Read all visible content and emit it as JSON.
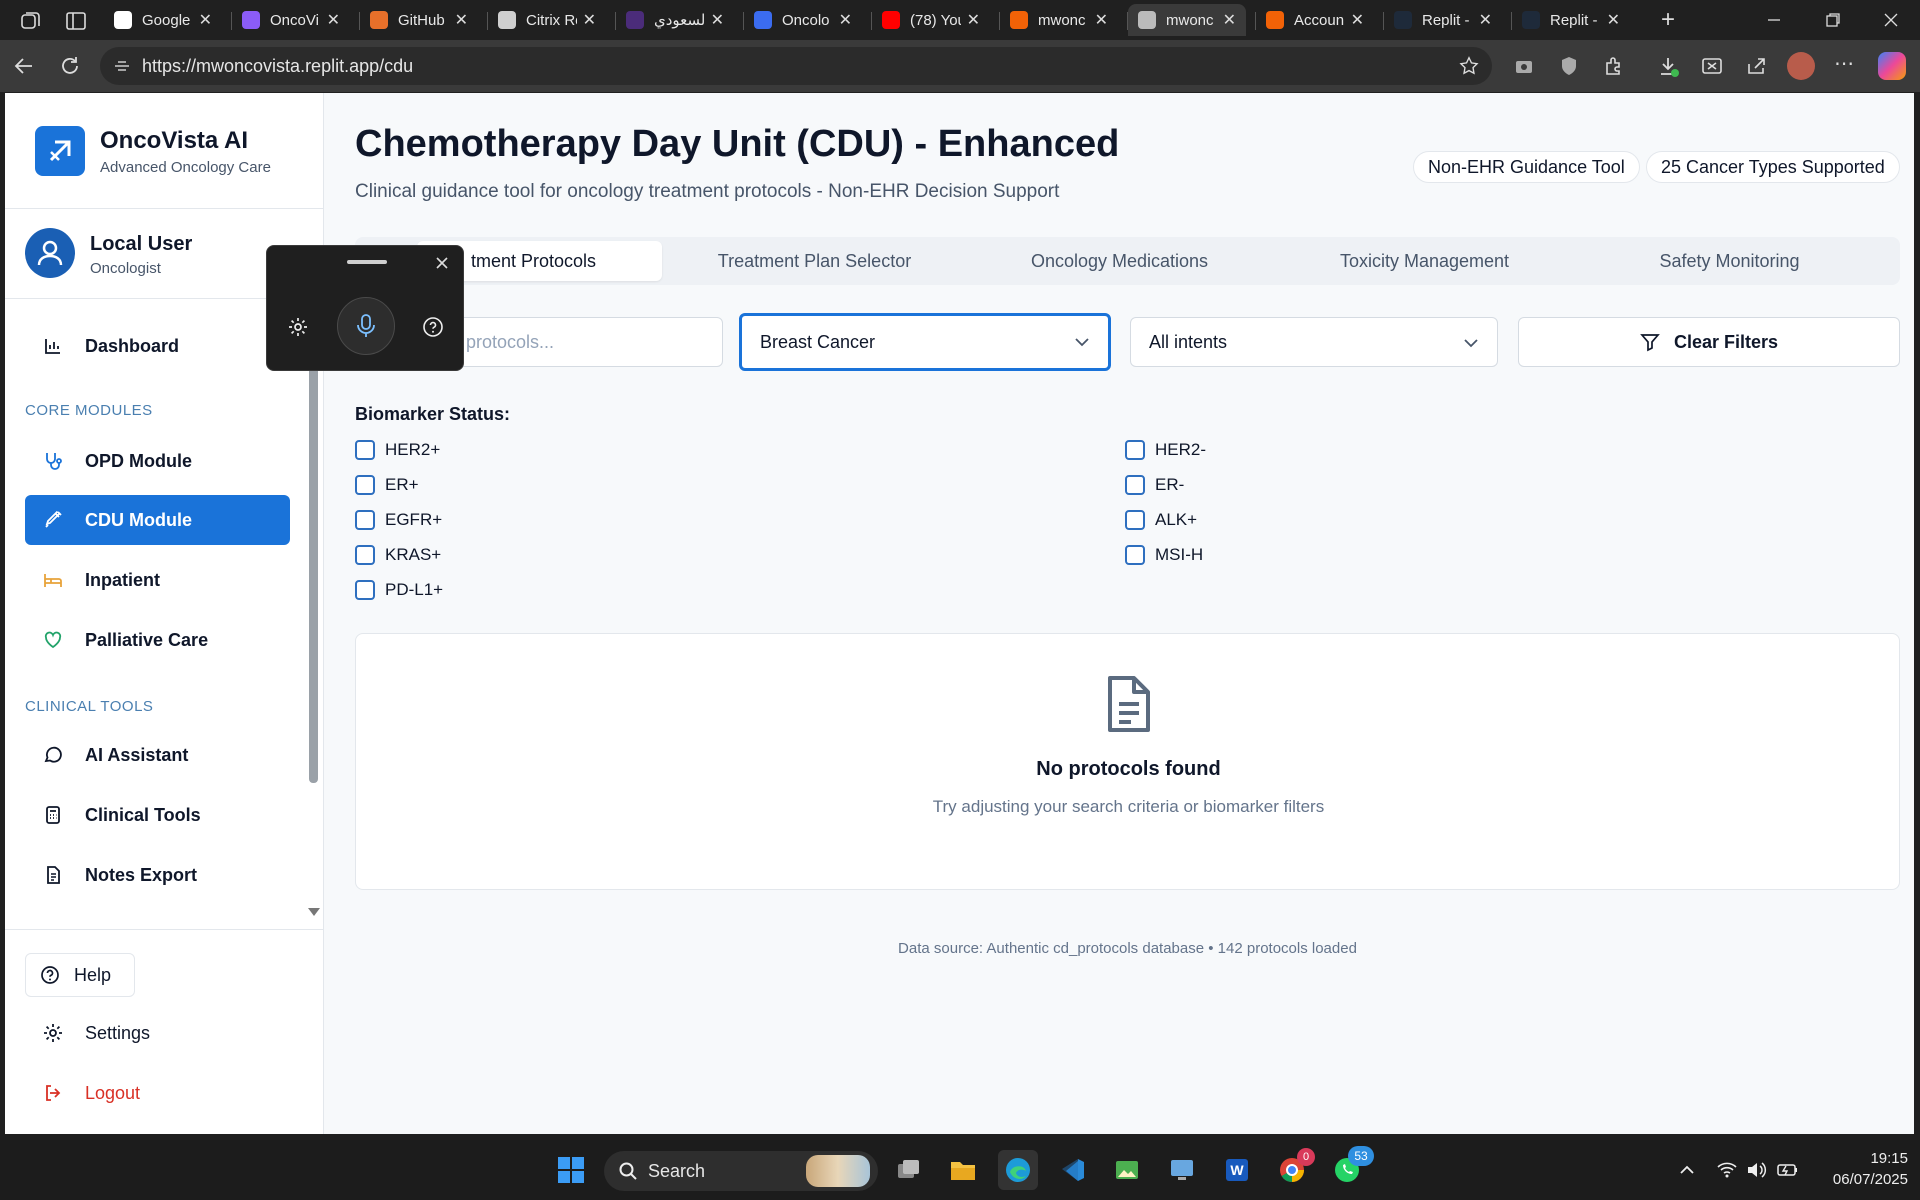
{
  "browser": {
    "tabs": [
      {
        "title": "",
        "fav_color": "#3c3c3c"
      },
      {
        "title": "",
        "fav_color": "#3c3c3c"
      },
      {
        "title": "Google",
        "fav_color": "#ffffff"
      },
      {
        "title": "OncoVi",
        "fav_color": "#8b5cf6"
      },
      {
        "title": "GitHub",
        "fav_color": "#e8702a"
      },
      {
        "title": "Citrix Re",
        "fav_color": "#cfcfcf"
      },
      {
        "title": "السعودي",
        "fav_color": "#4b2c7a"
      },
      {
        "title": "Oncolo",
        "fav_color": "#3b6cf0"
      },
      {
        "title": "(78) You",
        "fav_color": "#ff0000"
      },
      {
        "title": "mwonc",
        "fav_color": "#f26207"
      },
      {
        "title": "mwonc",
        "fav_color": "#bbbbbb"
      },
      {
        "title": "Accoun",
        "fav_color": "#f26207"
      },
      {
        "title": "Replit -",
        "fav_color": "#1e2a3a"
      },
      {
        "title": "Replit -",
        "fav_color": "#1e2a3a"
      }
    ],
    "url": "https://mwoncovista.replit.app/cdu"
  },
  "sidebar": {
    "brand_title": "OncoVista AI",
    "brand_subtitle": "Advanced Oncology Care",
    "user_name": "Local User",
    "user_role": "Oncologist",
    "dashboard": "Dashboard",
    "core_header": "CORE MODULES",
    "core_items": [
      "OPD Module",
      "CDU Module",
      "Inpatient",
      "Palliative Care"
    ],
    "tools_header": "CLINICAL TOOLS",
    "tools_items": [
      "AI Assistant",
      "Clinical Tools",
      "Notes Export"
    ],
    "help": "Help",
    "settings": "Settings",
    "logout": "Logout"
  },
  "main": {
    "title": "Chemotherapy Day Unit (CDU) - Enhanced",
    "subtitle": "Clinical guidance tool for oncology treatment protocols - Non-EHR Decision Support",
    "badge_1": "Non-EHR Guidance Tool",
    "badge_2": "25 Cancer Types Supported",
    "tabs": [
      "Treatment Protocols",
      "Treatment Plan Selector",
      "Oncology Medications",
      "Toxicity Management",
      "Safety Monitoring"
    ],
    "tab_partial_visible": "tment Protocols",
    "search_placeholder_visible": "protocols...",
    "cancer_select": "Breast Cancer",
    "intent_select": "All intents",
    "clear_filters": "Clear Filters",
    "biomarker_label": "Biomarker Status:",
    "biomarkers_left": [
      "HER2+",
      "ER+",
      "EGFR+",
      "KRAS+",
      "PD-L1+"
    ],
    "biomarkers_right": [
      "HER2-",
      "ER-",
      "ALK+",
      "MSI-H"
    ],
    "empty_title": "No protocols found",
    "empty_text": "Try adjusting your search criteria or biomarker filters",
    "footer": "Data source: Authentic cd_protocols database • 142 protocols loaded"
  },
  "taskbar": {
    "search": "Search",
    "time": "19:15",
    "date": "06/07/2025",
    "badge_chrome": "0",
    "badge_whatsapp": "53"
  },
  "colors": {
    "accent": "#1a73d9",
    "logout": "#d93025"
  }
}
